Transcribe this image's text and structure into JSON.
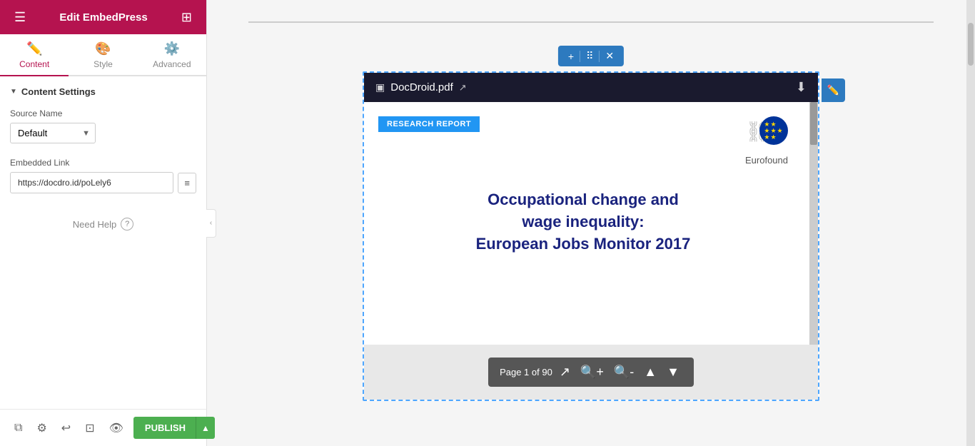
{
  "app": {
    "title": "Edit EmbedPress"
  },
  "tabs": [
    {
      "id": "content",
      "label": "Content",
      "icon": "✏️",
      "active": true
    },
    {
      "id": "style",
      "label": "Style",
      "icon": "🎨",
      "active": false
    },
    {
      "id": "advanced",
      "label": "Advanced",
      "icon": "⚙️",
      "active": false
    }
  ],
  "sidebar": {
    "section_title": "Content Settings",
    "source_name_label": "Source Name",
    "source_name_default": "Default",
    "embedded_link_label": "Embedded Link",
    "embedded_link_value": "https://docdro.id/poLely6",
    "need_help_label": "Need Help"
  },
  "footer": {
    "publish_label": "PUBLISH"
  },
  "pdf": {
    "filename": "DocDroid.pdf",
    "badge": "RESEARCH REPORT",
    "eurofound_label": "Eurofound",
    "title_line1": "Occupational change and",
    "title_line2": "wage inequality:",
    "title_line3": "European Jobs Monitor 2017",
    "page_info": "Page 1 of 90"
  },
  "widget_toolbar": {
    "add": "+",
    "move": "⠿",
    "close": "✕"
  }
}
